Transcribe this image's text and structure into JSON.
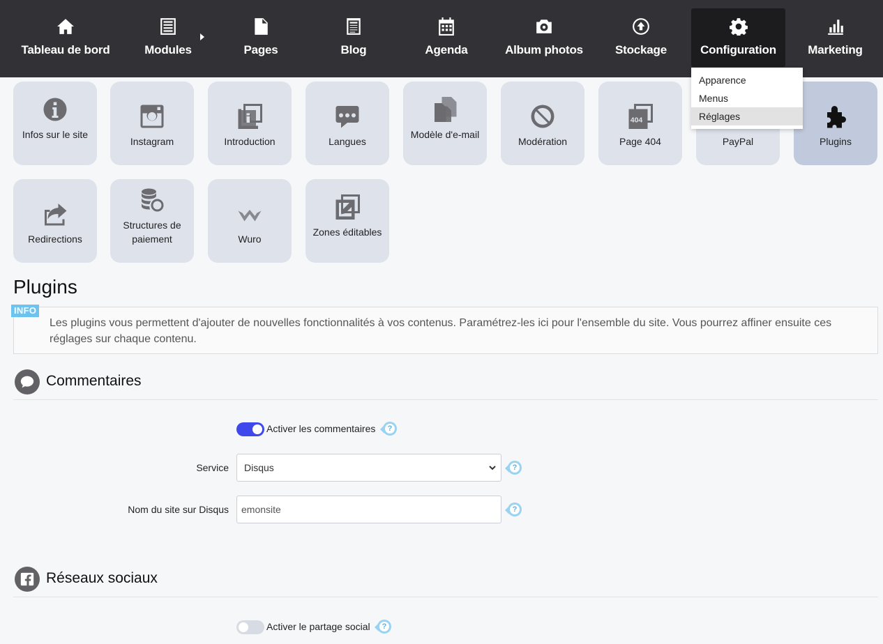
{
  "nav": {
    "items": [
      {
        "label": "Tableau de bord",
        "icon": "home-icon"
      },
      {
        "label": "Modules",
        "icon": "list-icon"
      },
      {
        "label": "Pages",
        "icon": "page-icon"
      },
      {
        "label": "Blog",
        "icon": "blog-icon"
      },
      {
        "label": "Agenda",
        "icon": "calendar-icon"
      },
      {
        "label": "Album photos",
        "icon": "camera-icon"
      },
      {
        "label": "Stockage",
        "icon": "upload-icon"
      },
      {
        "label": "Configuration",
        "icon": "gear-icon"
      },
      {
        "label": "Marketing",
        "icon": "bar-chart-icon"
      }
    ],
    "active": "Configuration"
  },
  "dropdown": {
    "items": [
      "Apparence",
      "Menus",
      "Réglages"
    ],
    "active": "Réglages"
  },
  "tiles": [
    {
      "label": "Infos sur le site",
      "icon": "info-icon"
    },
    {
      "label": "Instagram",
      "icon": "instagram-icon"
    },
    {
      "label": "Introduction",
      "icon": "introduction-icon"
    },
    {
      "label": "Langues",
      "icon": "speech-bubble-icon"
    },
    {
      "label": "Modèle d'e-mail",
      "icon": "documents-icon"
    },
    {
      "label": "Modération",
      "icon": "ban-icon"
    },
    {
      "label": "Page 404",
      "icon": "page-404-icon"
    },
    {
      "label": "PayPal",
      "icon": "paypal-icon"
    },
    {
      "label": "Plugins",
      "icon": "puzzle-icon"
    },
    {
      "label": "Redirections",
      "icon": "share-icon"
    },
    {
      "label": "Structures de paiement",
      "icon": "coins-icon"
    },
    {
      "label": "Wuro",
      "icon": "wuro-icon"
    },
    {
      "label": "Zones éditables",
      "icon": "edit-icon"
    }
  ],
  "page": {
    "title": "Plugins",
    "info_badge": "INFO",
    "info_text": "Les plugins vous permettent d'ajouter de nouvelles fonctionnalités à vos contenus. Paramétrez-les ici pour l'ensemble du site. Vous pourrez affiner ensuite ces réglages sur chaque contenu."
  },
  "comments": {
    "title": "Commentaires",
    "icon": "comment-icon",
    "toggle_label": "Activer les commentaires",
    "toggle_on": true,
    "service_label": "Service",
    "service_value": "Disqus",
    "disqus_label": "Nom du site sur Disqus",
    "disqus_value": "emonsite"
  },
  "social": {
    "title": "Réseaux sociaux",
    "icon": "facebook-icon",
    "toggle_label": "Activer le partage social",
    "toggle_on": false
  },
  "help_glyph": "?",
  "colors": {
    "nav_bg": "#323236",
    "nav_active": "#1c1c1f",
    "tile_bg": "#dde2eb",
    "tile_active": "#c0cadc",
    "toggle_on": "#3f48ea",
    "info_badge": "#6cc3ef"
  }
}
